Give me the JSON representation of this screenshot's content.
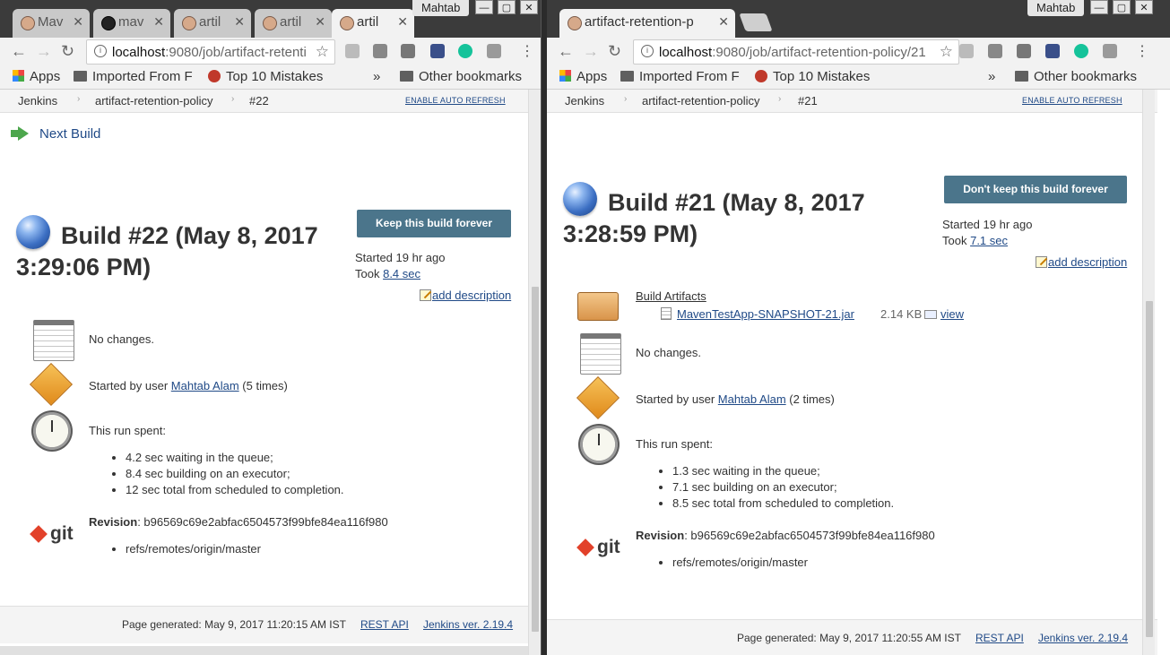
{
  "left": {
    "tabs": [
      {
        "label": "Mav",
        "icon": "jenkins-icon"
      },
      {
        "label": "mav",
        "icon": "github-icon"
      },
      {
        "label": "artil",
        "icon": "jenkins-icon"
      },
      {
        "label": "artil",
        "icon": "jenkins-icon"
      },
      {
        "label": "artil",
        "icon": "jenkins-icon",
        "active": true
      }
    ],
    "profile": "Mahtab",
    "url_host": "localhost",
    "url_path": ":9080/job/artifact-retenti",
    "bookmarks": {
      "apps": "Apps",
      "imported": "Imported From F",
      "top10": "Top 10 Mistakes",
      "more": "»",
      "other": "Other bookmarks"
    },
    "breadcrumb": [
      "Jenkins",
      "artifact-retention-policy",
      "#22"
    ],
    "auto_refresh": "ENABLE AUTO REFRESH",
    "next_build": "Next Build",
    "build_title_line1": "Build #22 (May 8, 2017",
    "build_title_line2": "3:29:06 PM)",
    "keep_button": "Keep this build forever",
    "started": "Started 19 hr ago",
    "took_label": "Took",
    "took_value": "8.4 sec",
    "add_description": "add description",
    "no_changes": "No changes.",
    "started_by_prefix": "Started by user",
    "started_by_user": "Mahtab Alam",
    "started_by_suffix": "(5 times)",
    "run_spent": "This run spent:",
    "run_items": [
      "4.2 sec waiting in the queue;",
      "8.4 sec building on an executor;",
      "12 sec total from scheduled to completion."
    ],
    "revision_label": "Revision",
    "revision_value": ": b96569c69e2abfac6504573f99bfe84ea116f980",
    "refs": "refs/remotes/origin/master",
    "git_logo": "git",
    "page_generated": "Page generated: May 9, 2017 11:20:15 AM IST",
    "rest_api": "REST API",
    "jenkins_ver": "Jenkins ver. 2.19.4"
  },
  "right": {
    "tab_label": "artifact-retention-p",
    "profile": "Mahtab",
    "url_host": "localhost",
    "url_path": ":9080/job/artifact-retention-policy/21",
    "bookmarks": {
      "apps": "Apps",
      "imported": "Imported From F",
      "top10": "Top 10 Mistakes",
      "more": "»",
      "other": "Other bookmarks"
    },
    "breadcrumb": [
      "Jenkins",
      "artifact-retention-policy",
      "#21"
    ],
    "auto_refresh": "ENABLE AUTO REFRESH",
    "build_title_line1": "Build #21 (May 8, 2017",
    "build_title_line2": "3:28:59 PM)",
    "dont_keep_button": "Don't keep this build forever",
    "started": "Started 19 hr ago",
    "took_label": "Took",
    "took_value": "7.1 sec",
    "add_description": "add description",
    "build_artifacts": "Build Artifacts",
    "artifact_file": "MavenTestApp-SNAPSHOT-21.jar",
    "artifact_size": "2.14 KB",
    "artifact_view": "view",
    "no_changes": "No changes.",
    "started_by_prefix": "Started by user",
    "started_by_user": "Mahtab Alam",
    "started_by_suffix": "(2 times)",
    "run_spent": "This run spent:",
    "run_items": [
      "1.3 sec waiting in the queue;",
      "7.1 sec building on an executor;",
      "8.5 sec total from scheduled to completion."
    ],
    "revision_label": "Revision",
    "revision_value": ": b96569c69e2abfac6504573f99bfe84ea116f980",
    "refs": "refs/remotes/origin/master",
    "git_logo": "git",
    "page_generated": "Page generated: May 9, 2017 11:20:55 AM IST",
    "rest_api": "REST API",
    "jenkins_ver": "Jenkins ver. 2.19.4"
  },
  "window_controls": {
    "minimize": "—",
    "maximize": "▢",
    "close": "✕"
  }
}
